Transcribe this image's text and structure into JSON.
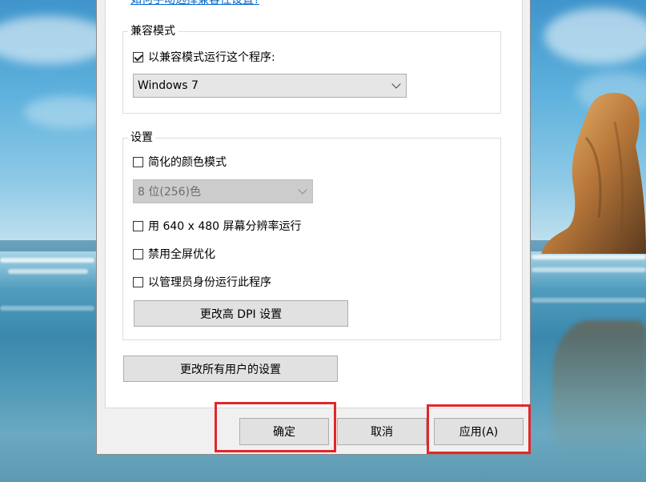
{
  "dialog": {
    "help_link": "如何手动选择兼容性设置?",
    "compat_group": {
      "title": "兼容模式",
      "checkbox_label": "以兼容模式运行这个程序:",
      "checked": true,
      "os_select_value": "Windows 7"
    },
    "settings_group": {
      "title": "设置",
      "reduced_color": {
        "label": "简化的颜色模式",
        "checked": false
      },
      "color_select_value": "8 位(256)色",
      "resolution_640": {
        "label": "用 640 x 480 屏幕分辨率运行",
        "checked": false
      },
      "disable_fullscreen_opt": {
        "label": "禁用全屏优化",
        "checked": false
      },
      "run_as_admin": {
        "label": "以管理员身份运行此程序",
        "checked": false
      },
      "high_dpi_button": "更改高 DPI 设置"
    },
    "all_users_button": "更改所有用户的设置",
    "footer": {
      "ok_button": "确定",
      "cancel_button": "取消",
      "apply_button": "应用(A)"
    }
  },
  "colors": {
    "highlight": "#e3262a",
    "link": "#0066cc",
    "dialog_bg": "#f0f0f0"
  }
}
